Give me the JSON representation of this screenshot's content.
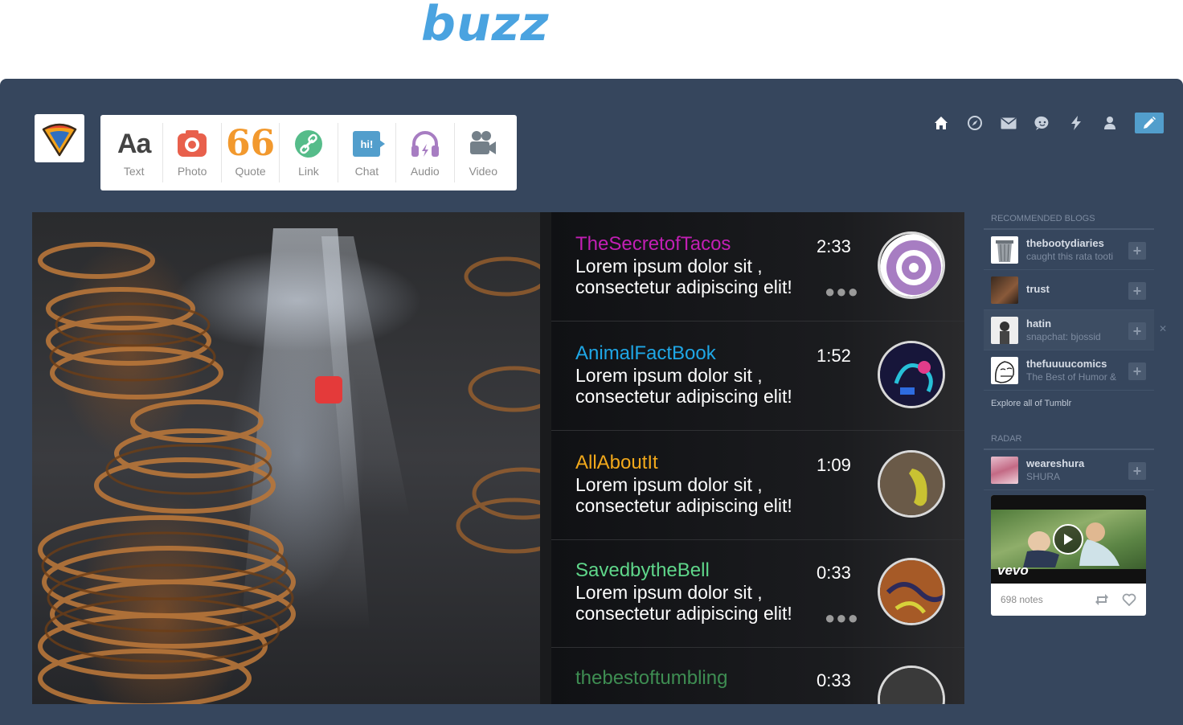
{
  "brand": {
    "logo_text": "buzz"
  },
  "post_types": [
    {
      "label": "Text",
      "icon": "text-aa-icon"
    },
    {
      "label": "Photo",
      "icon": "camera-icon"
    },
    {
      "label": "Quote",
      "icon": "quote-icon"
    },
    {
      "label": "Link",
      "icon": "link-icon"
    },
    {
      "label": "Chat",
      "icon": "chat-bubble-icon"
    },
    {
      "label": "Audio",
      "icon": "headphones-icon"
    },
    {
      "label": "Video",
      "icon": "video-camera-icon"
    }
  ],
  "post_type_icon_texts": {
    "text": "Aa",
    "quote": "66",
    "chat": "hi!"
  },
  "nav_icons": [
    "home-icon",
    "compass-icon",
    "mail-icon",
    "chat-icon",
    "lightning-icon",
    "account-icon",
    "pencil-icon"
  ],
  "feed": [
    {
      "name": "TheSecretofTacos",
      "color": "#c21fb4",
      "time": "2:33",
      "line1": "Lorem ipsum dolor sit ,",
      "line2": "consectetur adipiscing elit!",
      "dots": "●●●"
    },
    {
      "name": "AnimalFactBook",
      "color": "#1fa7e6",
      "time": "1:52",
      "line1": "Lorem ipsum dolor sit ,",
      "line2": "consectetur adipiscing elit!",
      "dots": ""
    },
    {
      "name": "AllAboutIt",
      "color": "#f1a81b",
      "time": "1:09",
      "line1": "Lorem ipsum dolor sit ,",
      "line2": "consectetur adipiscing elit!",
      "dots": ""
    },
    {
      "name": "SavedbytheBell",
      "color": "#5fd68a",
      "time": "0:33",
      "line1": "Lorem ipsum dolor sit ,",
      "line2": "consectetur adipiscing elit!",
      "dots": "●●●"
    },
    {
      "name": "thebestoftumbling",
      "color": "#3e8d52",
      "time": "0:33",
      "line1": "",
      "line2": "",
      "dots": ""
    }
  ],
  "sidebar": {
    "recommended_heading": "RECOMMENDED BLOGS",
    "blogs": [
      {
        "name": "thebootydiaries",
        "sub": "caught this rata tooti"
      },
      {
        "name": "trust",
        "sub": ""
      },
      {
        "name": "hatin",
        "sub": "snapchat: bjossid"
      },
      {
        "name": "thefuuuucomics",
        "sub": "The Best of Humor &"
      }
    ],
    "dismiss": "✕",
    "plus": "+",
    "explore": "Explore all of Tumblr",
    "radar_heading": "RADAR",
    "radar_blog": {
      "name": "weareshura",
      "sub": "SHURA"
    },
    "radar_post": {
      "brand": "vevo",
      "notes": "698 notes"
    }
  }
}
